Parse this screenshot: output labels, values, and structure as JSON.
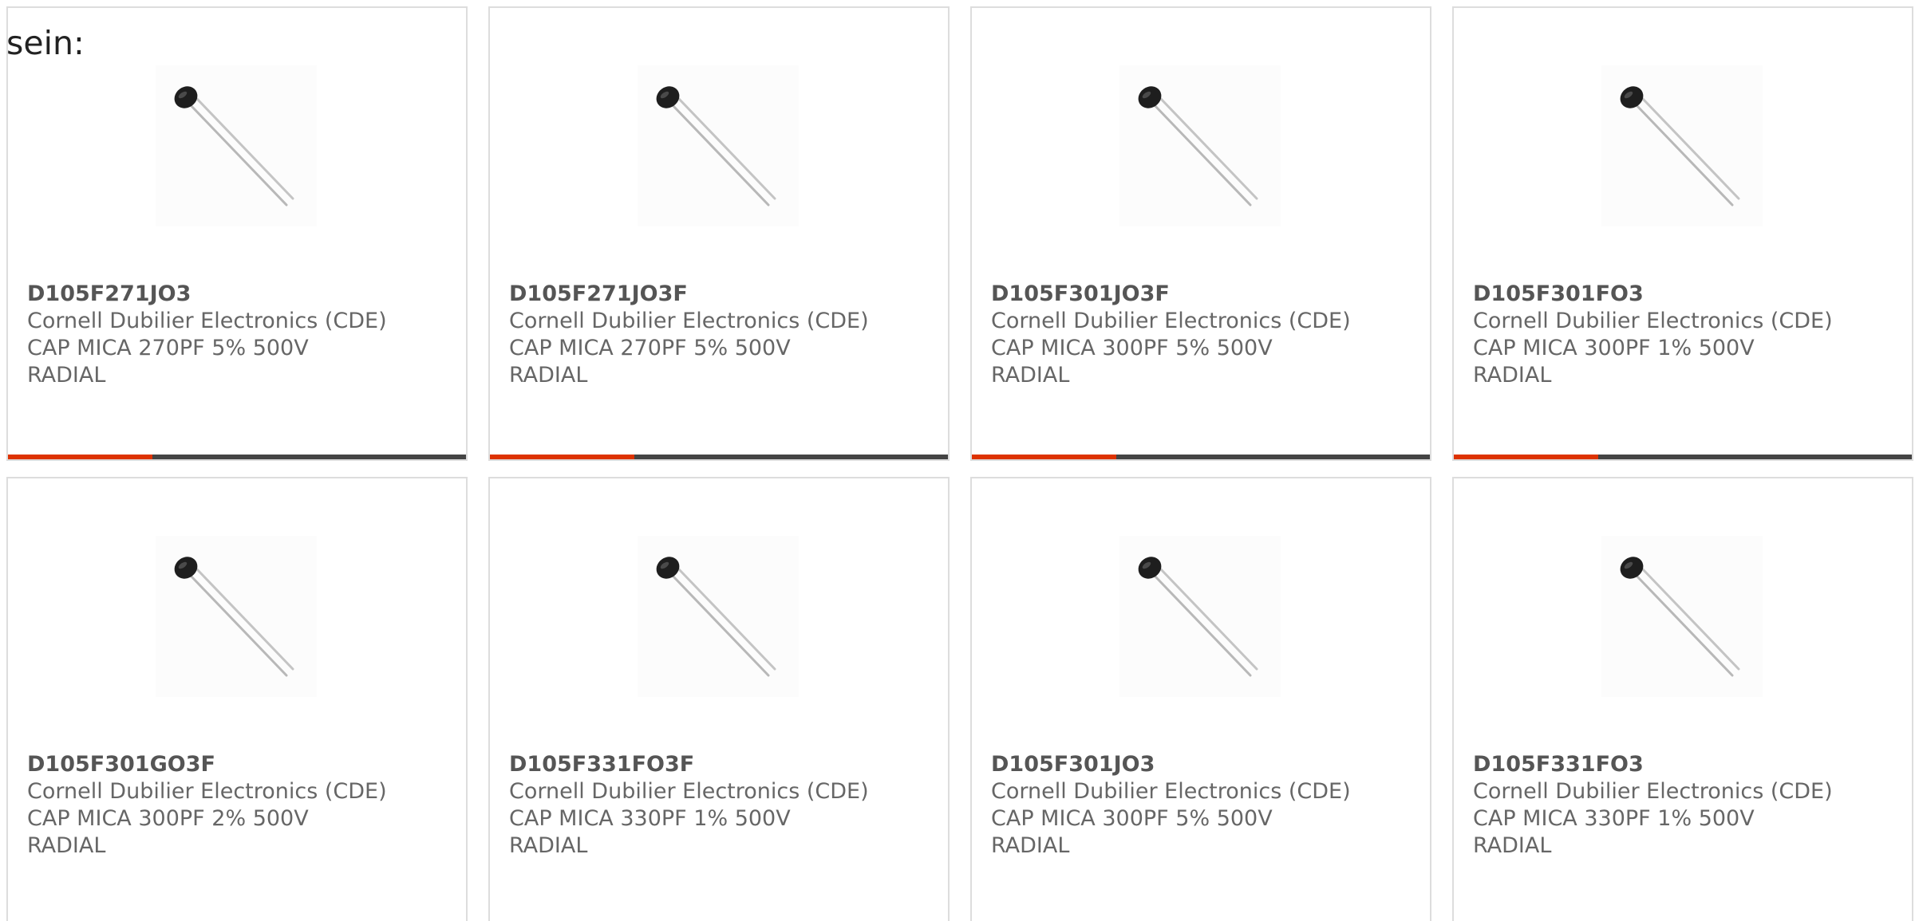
{
  "intro_text": "sein:",
  "colors": {
    "accent": "#dd3300",
    "bar_track": "#444444",
    "card_border": "#dddddd",
    "text": "#666666"
  },
  "products": [
    {
      "part_number": "D105F271JO3",
      "manufacturer": "Cornell Dubilier Electronics (CDE)",
      "desc_line1": "CAP MICA 270PF 5% 500V",
      "desc_line2": "RADIAL",
      "image_icon": "radial-capacitor-icon",
      "indicator_fraction": 0.315
    },
    {
      "part_number": "D105F271JO3F",
      "manufacturer": "Cornell Dubilier Electronics (CDE)",
      "desc_line1": "CAP MICA 270PF 5% 500V",
      "desc_line2": "RADIAL",
      "image_icon": "radial-capacitor-icon",
      "indicator_fraction": 0.315
    },
    {
      "part_number": "D105F301JO3F",
      "manufacturer": "Cornell Dubilier Electronics (CDE)",
      "desc_line1": "CAP MICA 300PF 5% 500V",
      "desc_line2": "RADIAL",
      "image_icon": "radial-capacitor-icon",
      "indicator_fraction": 0.315
    },
    {
      "part_number": "D105F301FO3",
      "manufacturer": "Cornell Dubilier Electronics (CDE)",
      "desc_line1": "CAP MICA 300PF 1% 500V",
      "desc_line2": "RADIAL",
      "image_icon": "radial-capacitor-icon",
      "indicator_fraction": 0.315
    },
    {
      "part_number": "D105F301GO3F",
      "manufacturer": "Cornell Dubilier Electronics (CDE)",
      "desc_line1": "CAP MICA 300PF 2% 500V",
      "desc_line2": "RADIAL",
      "image_icon": "radial-capacitor-icon"
    },
    {
      "part_number": "D105F331FO3F",
      "manufacturer": "Cornell Dubilier Electronics (CDE)",
      "desc_line1": "CAP MICA 330PF 1% 500V",
      "desc_line2": "RADIAL",
      "image_icon": "radial-capacitor-icon"
    },
    {
      "part_number": "D105F301JO3",
      "manufacturer": "Cornell Dubilier Electronics (CDE)",
      "desc_line1": "CAP MICA 300PF 5% 500V",
      "desc_line2": "RADIAL",
      "image_icon": "radial-capacitor-icon"
    },
    {
      "part_number": "D105F331FO3",
      "manufacturer": "Cornell Dubilier Electronics (CDE)",
      "desc_line1": "CAP MICA 330PF 1% 500V",
      "desc_line2": "RADIAL",
      "image_icon": "radial-capacitor-icon"
    }
  ]
}
